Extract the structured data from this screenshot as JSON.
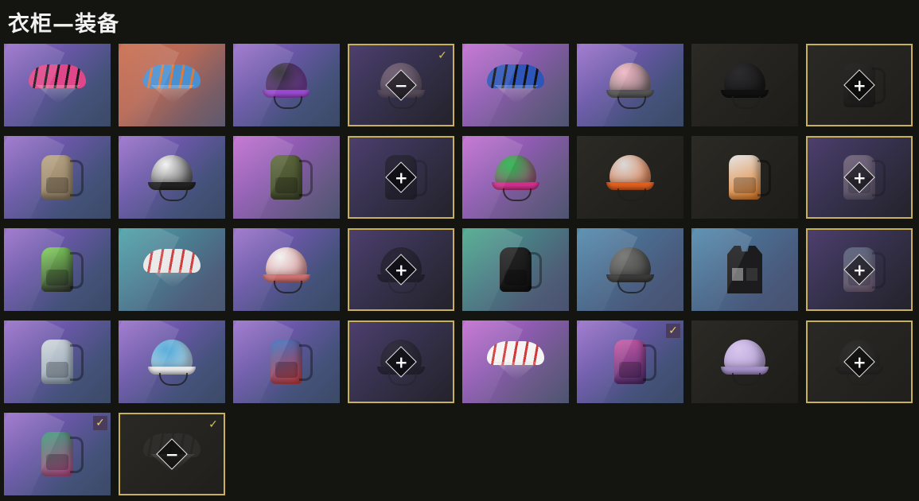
{
  "header": {
    "title": "衣柜—装备"
  },
  "icons": {
    "plus": "+",
    "minus": "−",
    "check": "✓"
  },
  "rows": [
    [
      {
        "kind": "parachute",
        "bg": "purple",
        "color": "#e0468a",
        "accent": "#1a1a1a",
        "state": "item"
      },
      {
        "kind": "parachute",
        "bg": "orange",
        "color": "#4a8fd0",
        "accent": "#e07a3a",
        "state": "item"
      },
      {
        "kind": "helmet",
        "bg": "purple",
        "color": "#2a2a2e",
        "accent": "#9a4ad0",
        "state": "item"
      },
      {
        "kind": "helmet",
        "bg": "purple",
        "color": "#c99aa5",
        "accent": "#8a6a6f",
        "state": "slot-minus",
        "checked": true
      },
      {
        "kind": "parachute",
        "bg": "magenta",
        "color": "#2e55b8",
        "accent": "#111",
        "state": "item"
      },
      {
        "kind": "helmet",
        "bg": "purple",
        "color": "#f0b7c4",
        "accent": "#555",
        "state": "item"
      },
      {
        "kind": "helmet",
        "bg": "dark",
        "color": "#2c2c2e",
        "accent": "#111",
        "state": "item"
      },
      {
        "kind": "backpack",
        "bg": "dark",
        "color": "#2f2f2f",
        "accent": "#111",
        "state": "slot-plus"
      }
    ],
    [
      {
        "kind": "backpack",
        "bg": "purple",
        "color": "#b9a585",
        "accent": "#8b7a60",
        "state": "item"
      },
      {
        "kind": "helmet",
        "bg": "purple",
        "color": "#f2f2f2",
        "accent": "#222",
        "state": "item"
      },
      {
        "kind": "backpack",
        "bg": "magenta",
        "color": "#5f6b3e",
        "accent": "#3d4428",
        "state": "item"
      },
      {
        "kind": "backpack",
        "bg": "purple",
        "color": "#1c1c1c",
        "accent": "#111",
        "state": "slot-plus"
      },
      {
        "kind": "helmet",
        "bg": "magenta",
        "color": "#24b24a",
        "accent": "#d0308c",
        "state": "item"
      },
      {
        "kind": "helmet",
        "bg": "dark",
        "color": "#d9d9d9",
        "accent": "#e06020",
        "state": "item"
      },
      {
        "kind": "backpack",
        "bg": "dark",
        "color": "#e6e6e6",
        "accent": "#e07a20",
        "state": "item"
      },
      {
        "kind": "backpack",
        "bg": "purple",
        "color": "#c9a7b8",
        "accent": "#8a7a95",
        "state": "slot-plus"
      }
    ],
    [
      {
        "kind": "backpack",
        "bg": "purple",
        "color": "#7fd25a",
        "accent": "#333",
        "state": "item"
      },
      {
        "kind": "parachute",
        "bg": "teal",
        "color": "#e8e8e8",
        "accent": "#d04040",
        "state": "item"
      },
      {
        "kind": "helmet",
        "bg": "purple",
        "color": "#f1f1f1",
        "accent": "#d07070",
        "state": "item"
      },
      {
        "kind": "helmet",
        "bg": "purple",
        "color": "#1a1a1a",
        "accent": "#111",
        "state": "slot-plus"
      },
      {
        "kind": "backpack",
        "bg": "green",
        "color": "#252525",
        "accent": "#111",
        "state": "item"
      },
      {
        "kind": "helmet",
        "bg": "steel",
        "color": "#6e6f6c",
        "accent": "#3a3a3a",
        "state": "item"
      },
      {
        "kind": "vest",
        "bg": "steel",
        "color": "#1c1c1e",
        "accent": "#777",
        "state": "item"
      },
      {
        "kind": "backpack",
        "bg": "purple",
        "color": "#7ab0c8",
        "accent": "#c88aa8",
        "state": "slot-plus"
      }
    ],
    [
      {
        "kind": "backpack",
        "bg": "purple",
        "color": "#cfd6dc",
        "accent": "#8fa0b0",
        "state": "item"
      },
      {
        "kind": "helmet",
        "bg": "purple",
        "color": "#4aa6d8",
        "accent": "#e8e8e8",
        "state": "item"
      },
      {
        "kind": "backpack",
        "bg": "purple",
        "color": "#3a6fc0",
        "accent": "#d04040",
        "state": "item"
      },
      {
        "kind": "helmet",
        "bg": "purple",
        "color": "#2a2a2a",
        "accent": "#111",
        "state": "slot-plus"
      },
      {
        "kind": "parachute",
        "bg": "magenta",
        "color": "#f4f4f4",
        "accent": "#d03a3a",
        "state": "item"
      },
      {
        "kind": "backpack",
        "bg": "purple",
        "color": "#c95aa8",
        "accent": "#4a2a6a",
        "state": "item",
        "checked": true
      },
      {
        "kind": "helmet",
        "bg": "dark",
        "color": "#d8c6ee",
        "accent": "#a590c8",
        "state": "item"
      },
      {
        "kind": "helmet",
        "bg": "dark",
        "color": "#3a3a3a",
        "accent": "#222",
        "state": "slot-plus"
      }
    ],
    [
      {
        "kind": "backpack",
        "bg": "purple",
        "color": "#3a9a7a",
        "accent": "#c04a8a",
        "state": "item",
        "checked": true
      },
      {
        "kind": "parachute",
        "bg": "dark",
        "color": "#3a3a38",
        "accent": "#2a2a28",
        "state": "slot-minus",
        "checked": true
      }
    ]
  ]
}
